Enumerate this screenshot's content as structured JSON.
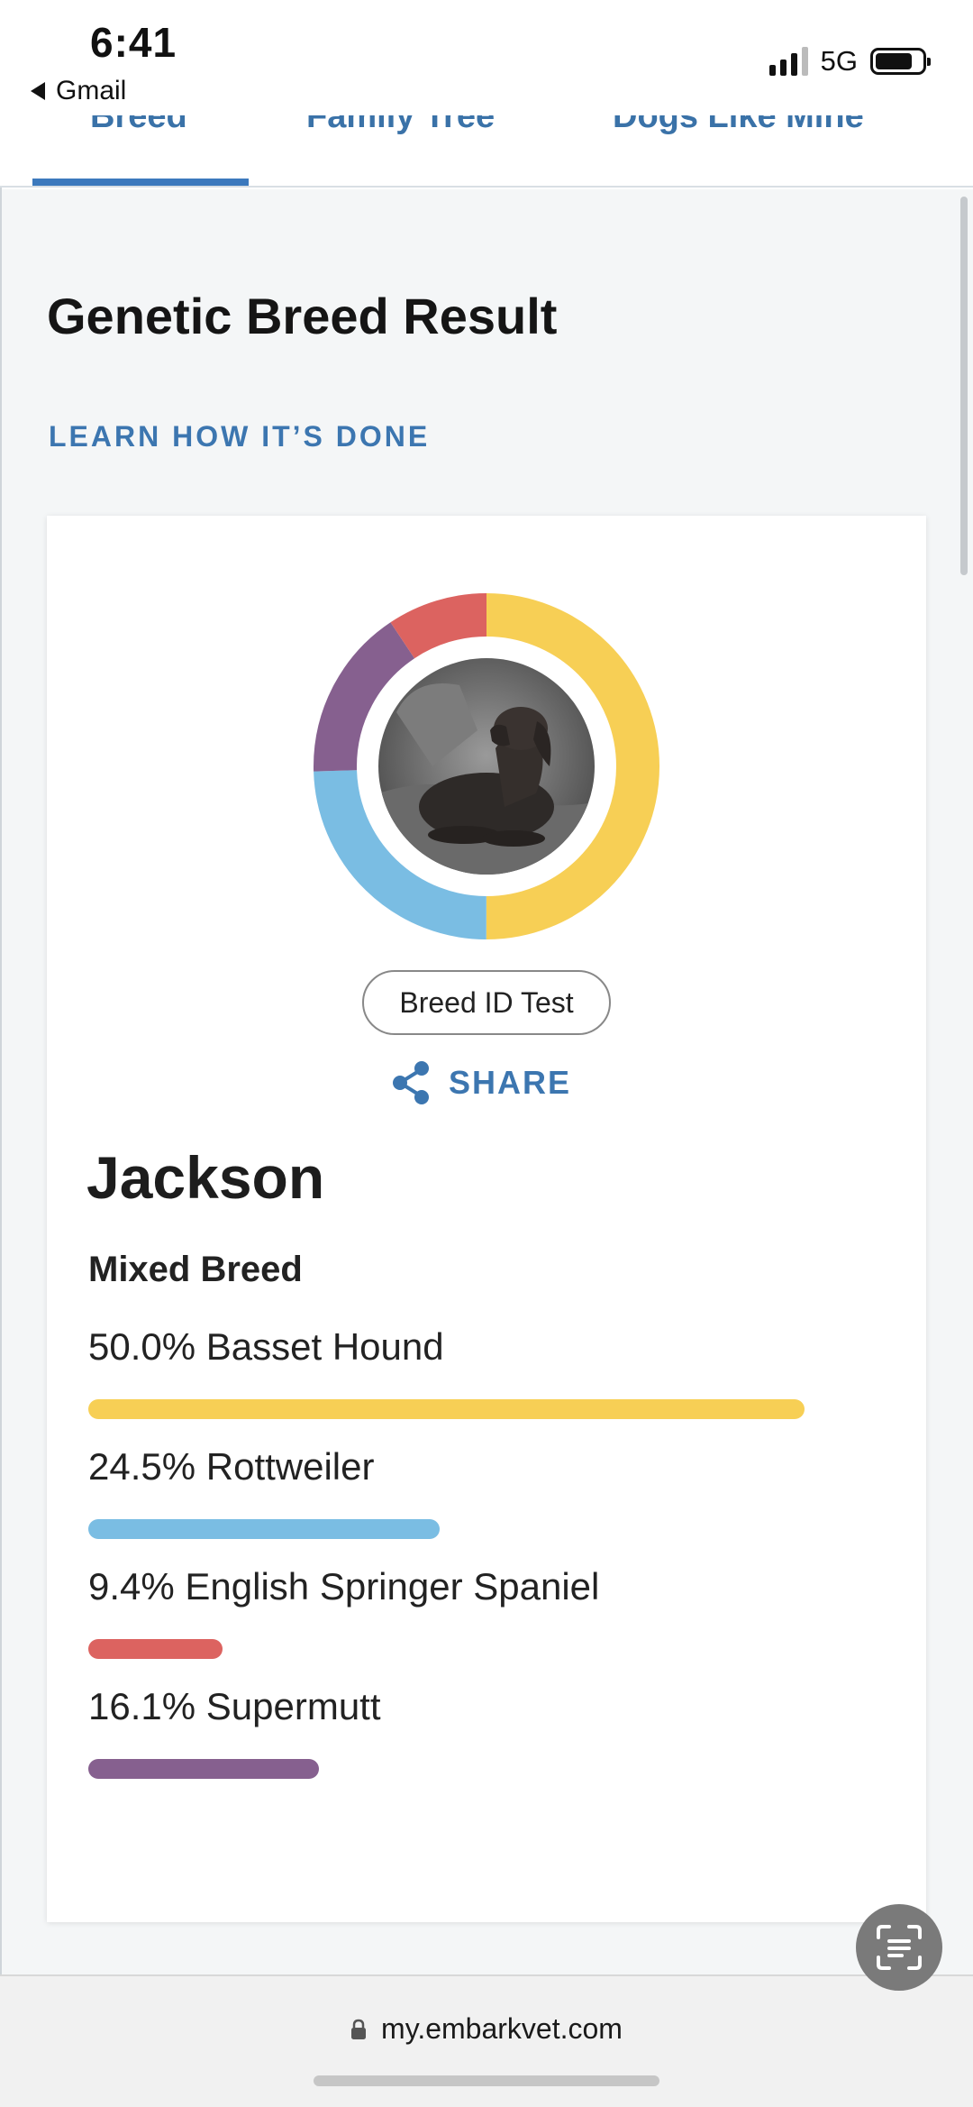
{
  "status_bar": {
    "time": "6:41",
    "back_app": "Gmail",
    "network": "5G"
  },
  "tabs": [
    {
      "label": "Breed",
      "active": true
    },
    {
      "label": "Family Tree",
      "active": false
    },
    {
      "label": "Dogs Like Mine",
      "active": false
    }
  ],
  "page": {
    "title": "Genetic Breed Result",
    "learn_link": "LEARN HOW IT’S DONE"
  },
  "result_card": {
    "test_pill": "Breed ID Test",
    "share_label": "SHARE",
    "dog_name": "Jackson",
    "breed_type": "Mixed Breed",
    "breeds": [
      {
        "label": "50.0% Basset Hound",
        "percent": 50.0,
        "color": "#F7CF55"
      },
      {
        "label": "24.5% Rottweiler",
        "percent": 24.5,
        "color": "#7ABDE3"
      },
      {
        "label": "9.4% English Springer Spaniel",
        "percent": 9.4,
        "color": "#DC6360"
      },
      {
        "label": "16.1% Supermutt",
        "percent": 16.1,
        "color": "#86608F"
      }
    ]
  },
  "colors": {
    "accent_blue": "#3C76B0",
    "tab_underline": "#3C79BD"
  },
  "icons": {
    "share": "share-icon",
    "scan_text": "scan-text-icon",
    "lock": "lock-icon"
  },
  "browser": {
    "url": "my.embarkvet.com"
  }
}
